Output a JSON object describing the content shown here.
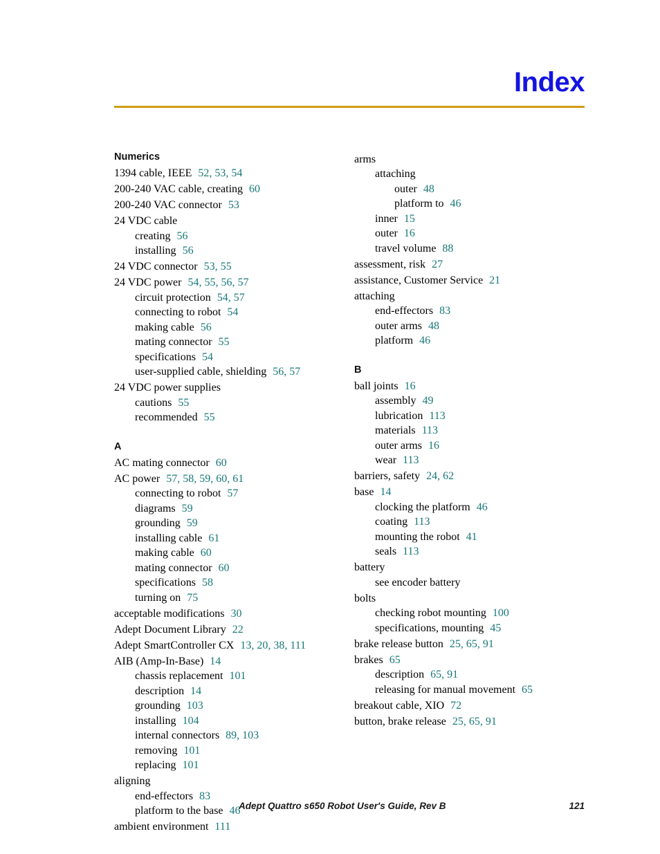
{
  "header": {
    "title": "Index",
    "rule_color": "#cf9c11",
    "title_color": "#1414e0"
  },
  "link_color": "#187878",
  "columns": [
    {
      "id": "left",
      "blocks": [
        {
          "heading": "Numerics",
          "entries": [
            {
              "level": 0,
              "term": "1394 cable, IEEE",
              "pages": "52, 53, 54"
            },
            {
              "level": 0,
              "term": "200-240 VAC cable, creating",
              "pages": "60"
            },
            {
              "level": 0,
              "term": "200-240 VAC connector",
              "pages": "53"
            },
            {
              "level": 0,
              "term": "24 VDC cable",
              "pages": ""
            },
            {
              "level": 1,
              "term": "creating",
              "pages": "56"
            },
            {
              "level": 1,
              "term": "installing",
              "pages": "56"
            },
            {
              "level": 0,
              "term": "24 VDC connector",
              "pages": "53, 55"
            },
            {
              "level": 0,
              "term": "24 VDC power",
              "pages": "54, 55, 56, 57"
            },
            {
              "level": 1,
              "term": "circuit protection",
              "pages": "54, 57"
            },
            {
              "level": 1,
              "term": "connecting to robot",
              "pages": "54"
            },
            {
              "level": 1,
              "term": "making cable",
              "pages": "56"
            },
            {
              "level": 1,
              "term": "mating connector",
              "pages": "55"
            },
            {
              "level": 1,
              "term": "specifications",
              "pages": "54"
            },
            {
              "level": 1,
              "term": "user-supplied cable, shielding",
              "pages": "56, 57"
            },
            {
              "level": 0,
              "term": "24 VDC power supplies",
              "pages": ""
            },
            {
              "level": 1,
              "term": "cautions",
              "pages": "55"
            },
            {
              "level": 1,
              "term": "recommended",
              "pages": "55"
            }
          ]
        },
        {
          "heading": "A",
          "entries": [
            {
              "level": 0,
              "term": "AC mating connector",
              "pages": "60"
            },
            {
              "level": 0,
              "term": "AC power",
              "pages": "57, 58, 59, 60, 61"
            },
            {
              "level": 1,
              "term": "connecting to robot",
              "pages": "57"
            },
            {
              "level": 1,
              "term": "diagrams",
              "pages": "59"
            },
            {
              "level": 1,
              "term": "grounding",
              "pages": "59"
            },
            {
              "level": 1,
              "term": "installing cable",
              "pages": "61"
            },
            {
              "level": 1,
              "term": "making cable",
              "pages": "60"
            },
            {
              "level": 1,
              "term": "mating connector",
              "pages": "60"
            },
            {
              "level": 1,
              "term": "specifications",
              "pages": "58"
            },
            {
              "level": 1,
              "term": "turning on",
              "pages": "75"
            },
            {
              "level": 0,
              "term": "acceptable modifications",
              "pages": "30"
            },
            {
              "level": 0,
              "term": "Adept Document Library",
              "pages": "22"
            },
            {
              "level": 0,
              "term": "Adept SmartController CX",
              "pages": "13, 20, 38, 111"
            },
            {
              "level": 0,
              "term": "AIB (Amp-In-Base)",
              "pages": "14"
            },
            {
              "level": 1,
              "term": "chassis replacement",
              "pages": "101"
            },
            {
              "level": 1,
              "term": "description",
              "pages": "14"
            },
            {
              "level": 1,
              "term": "grounding",
              "pages": "103"
            },
            {
              "level": 1,
              "term": "installing",
              "pages": "104"
            },
            {
              "level": 1,
              "term": "internal connectors",
              "pages": "89, 103"
            },
            {
              "level": 1,
              "term": "removing",
              "pages": "101"
            },
            {
              "level": 1,
              "term": "replacing",
              "pages": "101"
            },
            {
              "level": 0,
              "term": "aligning",
              "pages": ""
            },
            {
              "level": 1,
              "term": "end-effectors",
              "pages": "83"
            },
            {
              "level": 1,
              "term": "platform to the base",
              "pages": "46"
            },
            {
              "level": 0,
              "term": "ambient environment",
              "pages": "111"
            }
          ]
        }
      ]
    },
    {
      "id": "right",
      "blocks": [
        {
          "heading": "",
          "entries": [
            {
              "level": 0,
              "term": "arms",
              "pages": ""
            },
            {
              "level": 1,
              "term": "attaching",
              "pages": ""
            },
            {
              "level": 2,
              "term": "outer",
              "pages": "48"
            },
            {
              "level": 2,
              "term": "platform to",
              "pages": "46"
            },
            {
              "level": 1,
              "term": "inner",
              "pages": "15"
            },
            {
              "level": 1,
              "term": "outer",
              "pages": "16"
            },
            {
              "level": 1,
              "term": "travel volume",
              "pages": "88"
            },
            {
              "level": 0,
              "term": "assessment, risk",
              "pages": "27"
            },
            {
              "level": 0,
              "term": "assistance, Customer Service",
              "pages": "21"
            },
            {
              "level": 0,
              "term": "attaching",
              "pages": ""
            },
            {
              "level": 1,
              "term": "end-effectors",
              "pages": "83"
            },
            {
              "level": 1,
              "term": "outer arms",
              "pages": "48"
            },
            {
              "level": 1,
              "term": "platform",
              "pages": "46"
            }
          ]
        },
        {
          "heading": "B",
          "entries": [
            {
              "level": 0,
              "term": "ball joints",
              "pages": "16"
            },
            {
              "level": 1,
              "term": "assembly",
              "pages": "49"
            },
            {
              "level": 1,
              "term": "lubrication",
              "pages": "113"
            },
            {
              "level": 1,
              "term": "materials",
              "pages": "113"
            },
            {
              "level": 1,
              "term": "outer arms",
              "pages": "16"
            },
            {
              "level": 1,
              "term": "wear",
              "pages": "113"
            },
            {
              "level": 0,
              "term": "barriers, safety",
              "pages": "24, 62"
            },
            {
              "level": 0,
              "term": "base",
              "pages": "14"
            },
            {
              "level": 1,
              "term": "clocking the platform",
              "pages": "46"
            },
            {
              "level": 1,
              "term": "coating",
              "pages": "113"
            },
            {
              "level": 1,
              "term": "mounting the robot",
              "pages": "41"
            },
            {
              "level": 1,
              "term": "seals",
              "pages": "113"
            },
            {
              "level": 0,
              "term": "battery",
              "pages": ""
            },
            {
              "level": 1,
              "term": "see encoder battery",
              "pages": ""
            },
            {
              "level": 0,
              "term": "bolts",
              "pages": ""
            },
            {
              "level": 1,
              "term": "checking robot mounting",
              "pages": "100"
            },
            {
              "level": 1,
              "term": "specifications, mounting",
              "pages": "45"
            },
            {
              "level": 0,
              "term": "brake release button",
              "pages": "25, 65, 91"
            },
            {
              "level": 0,
              "term": "brakes",
              "pages": "65"
            },
            {
              "level": 1,
              "term": "description",
              "pages": "65, 91"
            },
            {
              "level": 1,
              "term": "releasing for manual movement",
              "pages": "65"
            },
            {
              "level": 0,
              "term": "breakout cable, XIO",
              "pages": "72"
            },
            {
              "level": 0,
              "term": "button, brake release",
              "pages": "25, 65, 91"
            }
          ]
        }
      ]
    }
  ],
  "footer": {
    "document_title": "Adept Quattro s650 Robot User's Guide, Rev B",
    "page_number": "121"
  }
}
